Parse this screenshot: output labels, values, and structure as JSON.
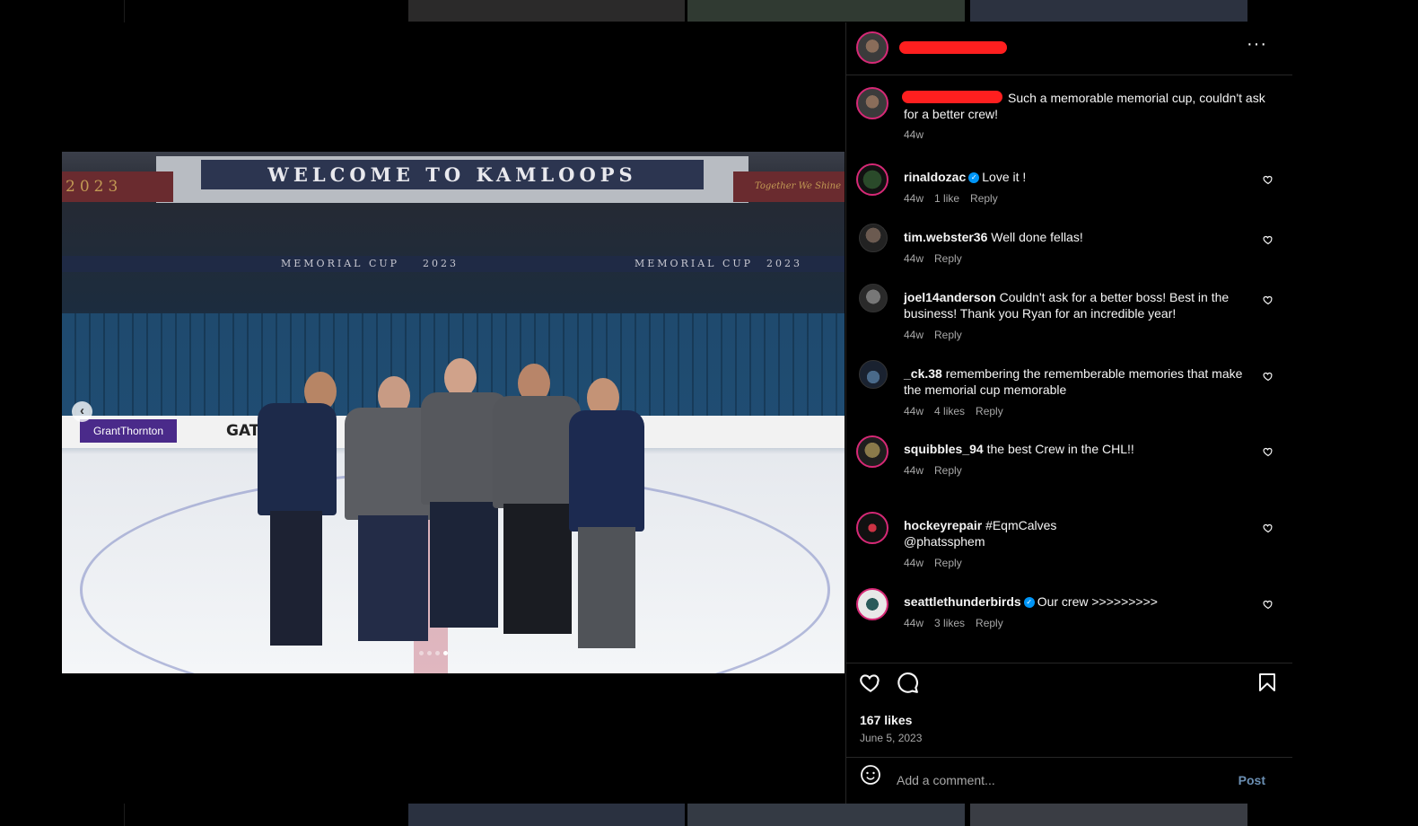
{
  "photo": {
    "welcome_text": "WELCOME TO KAMLOOPS",
    "year_left": "2023",
    "slogan_right": "Together We Shine",
    "ribbon_left": "MEMORIAL CUP",
    "ribbon_right": "MEMORIAL CUP",
    "ribbon_year": "2023",
    "sponsor_1": "GrantThornton",
    "sponsor_2": "GATOR",
    "carousel_dots": 4,
    "carousel_active": 4,
    "prev_glyph": "‹"
  },
  "post": {
    "more_glyph": "···",
    "caption_text": "Such a memorable memorial cup, couldn't ask for a better crew!",
    "caption_time": "44w",
    "likes": "167 likes",
    "date": "June 5, 2023",
    "add_comment_placeholder": "Add a comment...",
    "post_label": "Post"
  },
  "comments": [
    {
      "user": "rinaldozac",
      "verified": true,
      "text": "Love it !",
      "time": "44w",
      "likes": "1 like",
      "reply": "Reply"
    },
    {
      "user": "tim.webster36",
      "verified": false,
      "text": "Well done fellas!",
      "time": "44w",
      "likes": "",
      "reply": "Reply"
    },
    {
      "user": "joel14anderson",
      "verified": false,
      "text": "Couldn't ask for a better boss! Best in the business! Thank you Ryan for an incredible year!",
      "time": "44w",
      "likes": "",
      "reply": "Reply"
    },
    {
      "user": "_ck.38",
      "verified": false,
      "text": "remembering the rememberable memories that make the memorial cup memorable",
      "time": "44w",
      "likes": "4 likes",
      "reply": "Reply"
    },
    {
      "user": "squibbles_94",
      "verified": false,
      "text": "the best Crew in the CHL!!",
      "time": "44w",
      "likes": "",
      "reply": "Reply"
    },
    {
      "user": "hockeyrepair",
      "verified": false,
      "text": "#EqmCalves",
      "text2": "@phatssphem",
      "time": "44w",
      "likes": "",
      "reply": "Reply"
    },
    {
      "user": "seattlethunderbirds",
      "verified": true,
      "text": "Our crew >>>>>>>>>",
      "time": "44w",
      "likes": "3 likes",
      "reply": "Reply"
    }
  ],
  "icons": {
    "heart": "heart-icon",
    "comment": "comment-icon",
    "bookmark": "bookmark-icon",
    "emoji": "emoji-icon",
    "more": "more-options-icon",
    "verified": "verified-badge-icon"
  }
}
